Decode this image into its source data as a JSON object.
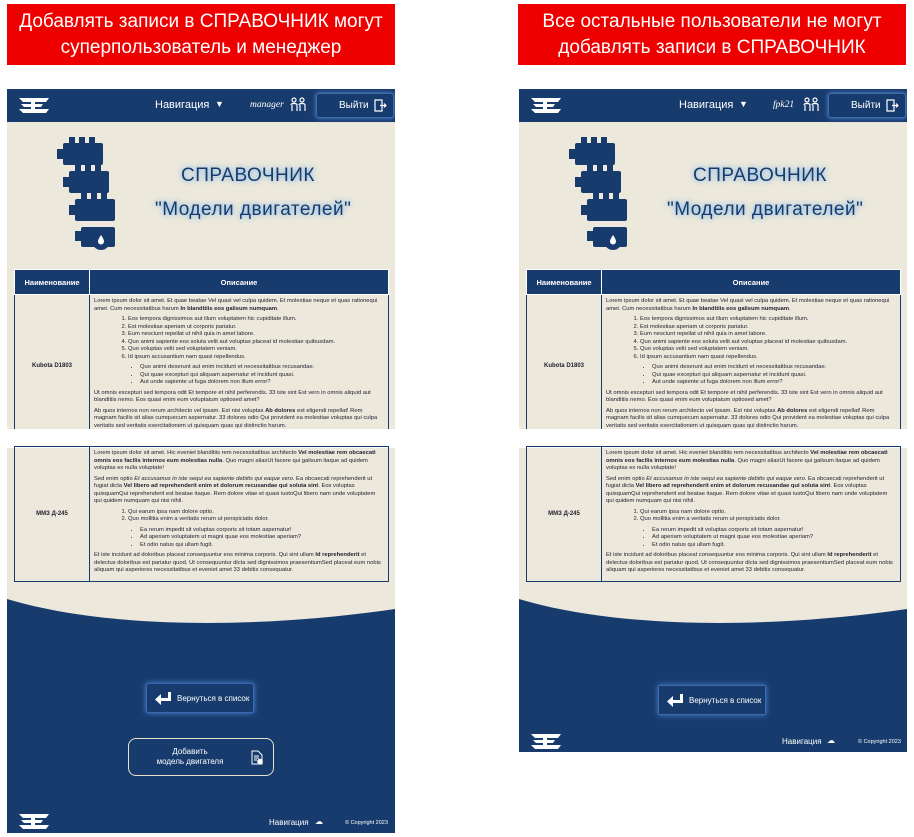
{
  "banners": {
    "left": "Добавлять записи в СПРАВОЧНИК могут суперпользователь и менеджер",
    "right": "Все остальные пользователи не могут добавлять записи в СПРАВОЧНИК"
  },
  "header": {
    "nav_label": "Навигация",
    "logout_label": "Выйти"
  },
  "users": {
    "left": "manager",
    "right": "fpk21"
  },
  "title": {
    "line1": "СПРАВОЧНИК",
    "line2": "\"Модели двигателей\""
  },
  "table": {
    "col_name": "Наименование",
    "col_desc": "Описание",
    "rows": [
      {
        "name": "Kubota D1803",
        "p1a": "Lorem ipsum dolor sit amet. Et quae beatae Vel quasi vel culpa quidem. Et molestiae neque et quas rationequi amet. Cum necessitatibus harum ",
        "p1b": "In blanditiis eos galisum numquam",
        "ol": [
          "Eos tempora dignissimos aut illum voluptatem hic cupiditate illum.",
          "Est molestiae aperiam ut corporis pariatur.",
          "Eum nesciunt repellat ut nihil quia in amet labore.",
          "Quo animi sapiente eos soluta velit aut voluptas placeat id molestiae quibusdam.",
          "Quo voluptas velit sed voluptatem veniam.",
          "Id ipsum accusantium nam quasi repellendus."
        ],
        "ul": [
          "Quo animi deserunt aut enim incidunt et necessitatibus recusandae.",
          "Qui quae excepturi qui aliquam aspernatur et incidunt quasi.",
          "Aut unde sapiente ut fuga dolorem non illum error?"
        ],
        "p2": "Ut omnis excepturi sed tempora odit Et tempore et nihil perferendis. 33 iste sint Est vero in omnis aliquid aut blanditiis nemo. Eos quasi enim eum voluptatum optiosed amet?",
        "p3a": "Ab quos internos non rerum architecto vel ipsam. Est nisi voluptas ",
        "p3b": "Ab dolores",
        "p3c": " est eligendi repellat! Rem magnam facilis sit alias cumquecum aspernatur. 33 dolores odio Qui provident ea molestiae voluptas qui culpa veritatis sed veritatis exercitationem ut quisquam quas qui distinctio harum."
      },
      {
        "name": "ММЗ Д-245",
        "p1a": "Lorem ipsum dolor sit amet. Hic eveniet blanditiis rem necessitatibus architecto ",
        "p1b": "Vel molestiae rem obcaecati omnis eos facilis internos eum molestias nulla",
        "p1c": ". Quo magni aliasUt facere qui galisum itaque ad quidem voluptas ex nulla voluptate!",
        "p2a": "Sed enim optio ",
        "p2b": "Et accusamus in iste sequi ea sapiente debitis qui eaque vero",
        "p2c": ". Ea obcaecati reprehenderit ut fugiat dicta ",
        "p2d": "Vel libero ad reprehenderit enim et dolorum recusandae qui soluta sint",
        "p2e": ". Eos voluptas quisquamQui reprehenderit est beatae itaque. Rem dolore vitae et quasi iustoQui libero nam unde voluptatem qui quidem numquam qui nisi nihil.",
        "ol": [
          "Qui earum ipsa nam dolore optio.",
          "Quo mollitia enim a veritatis rerum ut perspiciatis dolor."
        ],
        "ul": [
          "Ea rerum impedit sit voluptas corporis sit totam aspernatur!",
          "Ad aperiam voluptatem ut magni quae eos molestiae aperiam?",
          "Et odio natus qui ullam fugit."
        ],
        "p3a": "Et iste incidunt ad doloribus placeat consequuntur eos minima corporis. Qui sint ullam ",
        "p3b": "Id reprehenderit",
        "p3c": " et delectus doloribus est pariatur quod. Ut consequuntur dicta sed dignissimos praesentiumSed placeat eum nobis aliquam qui asperiores necessitatibus et eveniet amet 33 debitis consequatur."
      }
    ]
  },
  "buttons": {
    "back": "Вернуться в список",
    "add_line1": "Добавить",
    "add_line2": "модель двигателя"
  },
  "footer": {
    "nav_label": "Навигация",
    "copyright": "© Copyright 2023"
  },
  "colors": {
    "banner_red": "#ee0000",
    "navy": "#173b6d",
    "beige": "#ece8dc"
  }
}
